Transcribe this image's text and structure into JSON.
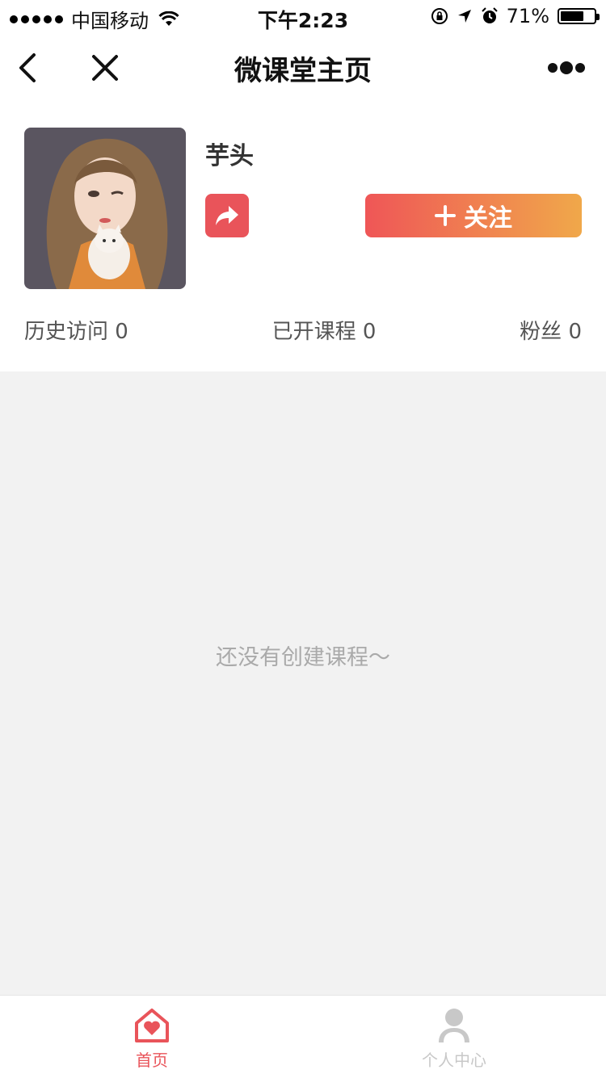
{
  "status_bar": {
    "carrier": "中国移动",
    "time": "下午2:23",
    "battery_percent": "71%",
    "battery_level": 0.71
  },
  "nav": {
    "title": "微课堂主页"
  },
  "profile": {
    "name": "芋头",
    "follow_label": "关注",
    "stats": [
      {
        "label": "历史访问",
        "value": "0"
      },
      {
        "label": "已开课程",
        "value": "0"
      },
      {
        "label": "粉丝",
        "value": "0"
      }
    ]
  },
  "content": {
    "empty_text": "还没有创建课程～"
  },
  "tabbar": {
    "tabs": [
      {
        "label": "首页",
        "active": true
      },
      {
        "label": "个人中心",
        "active": false
      }
    ]
  },
  "colors": {
    "accent": "#e9545a",
    "gradient_start": "#ef5657",
    "gradient_end": "#f0a84a",
    "background_gray": "#f2f2f2"
  },
  "icons": [
    "signal-icon",
    "wifi-icon",
    "orientation-lock-icon",
    "location-icon",
    "alarm-icon",
    "battery-icon",
    "back-icon",
    "close-icon",
    "more-icon",
    "share-icon",
    "plus-icon",
    "home-heart-icon",
    "person-icon"
  ]
}
